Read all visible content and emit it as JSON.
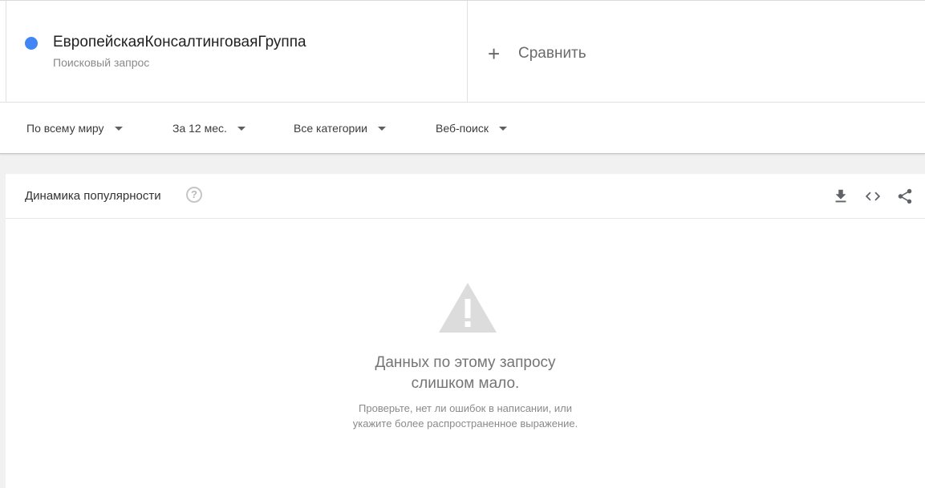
{
  "term": {
    "name": "ЕвропейскаяКонсалтинговаяГруппа",
    "type": "Поисковый запрос",
    "dot_color": "#4285f4"
  },
  "compare": {
    "icon": "plus-icon",
    "label": "Сравнить"
  },
  "filters": [
    {
      "label": "По всему миру",
      "icon": "caret-down-icon"
    },
    {
      "label": "За 12 мес.",
      "icon": "caret-down-icon"
    },
    {
      "label": "Все категории",
      "icon": "caret-down-icon"
    },
    {
      "label": "Веб-поиск",
      "icon": "caret-down-icon"
    }
  ],
  "panel": {
    "title": "Динамика популярности",
    "help_icon": "help-icon",
    "tools": [
      "download-icon",
      "embed-icon",
      "share-icon"
    ]
  },
  "empty_state": {
    "icon": "warning-icon",
    "title_line1": "Данных по этому запросу",
    "title_line2": "слишком мало.",
    "hint_line1": "Проверьте, нет ли ошибок в написании, или",
    "hint_line2": "укажите более распространенное выражение."
  }
}
